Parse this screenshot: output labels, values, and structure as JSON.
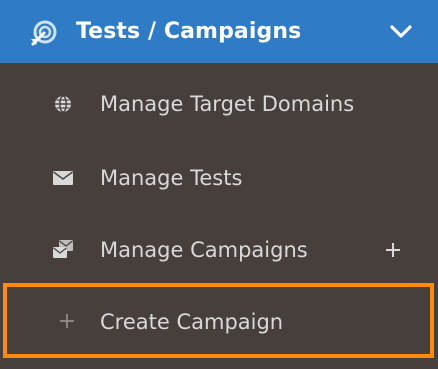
{
  "header": {
    "title": "Tests / Campaigns",
    "icon": "target-arrow-icon",
    "toggle_icon": "chevron-down-icon"
  },
  "menu_items": [
    {
      "label": "Manage Target Domains",
      "icon": "globe-icon"
    },
    {
      "label": "Manage Tests",
      "icon": "envelope-icon"
    },
    {
      "label": "Manage Campaigns",
      "icon": "campaign-mail-icon",
      "expand_icon": "plus-icon"
    },
    {
      "label": "Create Campaign",
      "icon": "plus-icon",
      "highlighted": true
    }
  ],
  "colors": {
    "header_bg": "#2f7bc5",
    "menu_bg": "#463f3c",
    "text": "#d9d9d9",
    "highlight_border": "#ff8a10"
  }
}
